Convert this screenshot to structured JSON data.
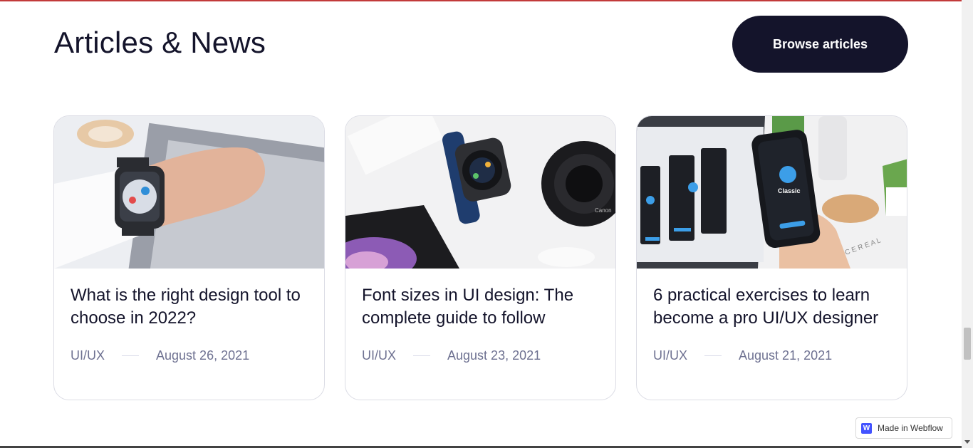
{
  "section": {
    "title": "Articles & News",
    "browse_label": "Browse articles"
  },
  "articles": [
    {
      "title": "What is the right design tool to choose in 2022?",
      "category": "UI/UX",
      "date": "August 26, 2021",
      "image": "smartwatch-on-wrist-photo"
    },
    {
      "title": "Font sizes in UI design: The complete guide to follow",
      "category": "UI/UX",
      "date": "August 23, 2021",
      "image": "smartwatch-and-camera-lens-photo"
    },
    {
      "title": "6 practical exercises to learn become a pro UI/UX designer",
      "category": "UI/UX",
      "date": "August 21, 2021",
      "image": "phone-app-mockup-photo"
    }
  ],
  "badge": {
    "label": "Made in Webflow",
    "logo_letter": "W"
  }
}
